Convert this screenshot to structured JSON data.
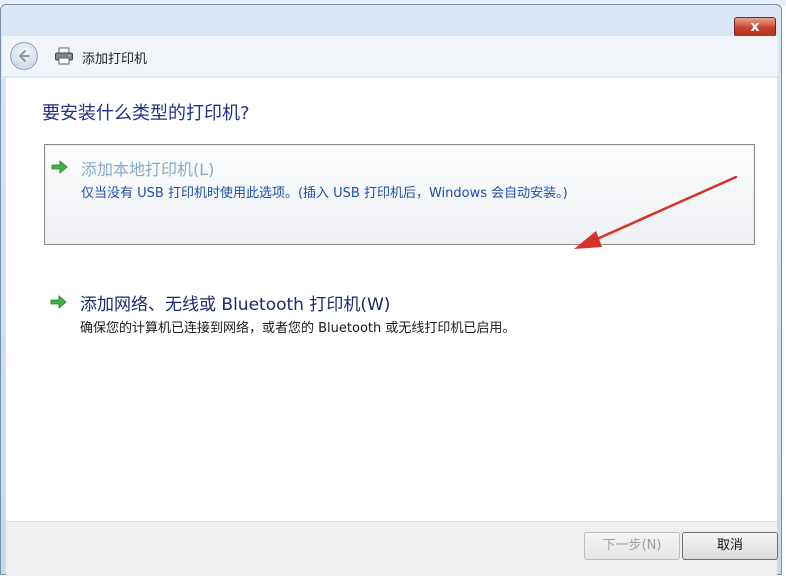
{
  "window": {
    "title": "添加打印机",
    "close_symbol": "x"
  },
  "main": {
    "heading": "要安装什么类型的打印机?",
    "options": [
      {
        "title": "添加本地打印机(L)",
        "description": "仅当没有 USB 打印机时使用此选项。(插入 USB 打印机后，Windows 会自动安装。)",
        "icon": "green-arrow-icon"
      },
      {
        "title": "添加网络、无线或 Bluetooth 打印机(W)",
        "description": "确保您的计算机已连接到网络，或者您的 Bluetooth 或无线打印机已启用。",
        "icon": "green-arrow-icon"
      }
    ]
  },
  "footer": {
    "next_label": "下一步(N)",
    "cancel_label": "取消"
  },
  "colors": {
    "accent_red": "#d9302a",
    "heading_blue": "#1e3287",
    "link_blue": "#1e4fa8"
  }
}
